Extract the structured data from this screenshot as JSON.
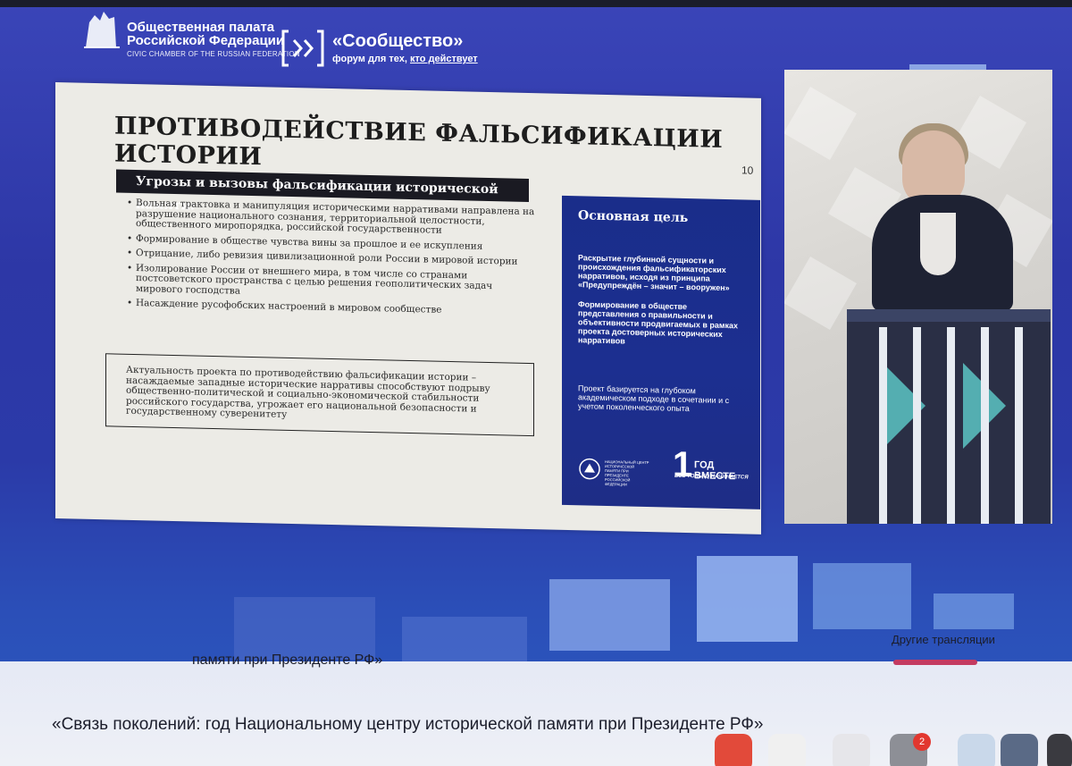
{
  "header": {
    "opp_line1": "Общественная палата",
    "opp_line2": "Российской Федерации",
    "opp_line3": "CIVIC CHAMBER OF THE RUSSIAN FEDERATION",
    "forum_title": "«Сообщество»",
    "forum_sub_prefix": "форум для тех,",
    "forum_sub_link": "кто действует"
  },
  "slide": {
    "title": "ПРОТИВОДЕЙСТВИЕ ФАЛЬСИФИКАЦИИ ИСТОРИИ",
    "page_number": "10",
    "threats_heading": "Угрозы и вызовы фальсификации исторической памяти:",
    "threats": [
      "Вольная трактовка и манипуляция историческими нарративами направлена на разрушение национального сознания, территориальной целостности, общественного миропорядка, российской государственности",
      "Формирование в обществе чувства вины за прошлое и ее искупления",
      "Отрицание, либо ревизия цивилизационной роли России в мировой истории",
      "Изолирование России от внешнего мира, в том числе со странами постсоветского пространства с целью решения геополитических задач мирового господства",
      "Насаждение русофобских настроений в мировом сообществе"
    ],
    "relevance_text": "Актуальность проекта по противодействию фальсификации истории – насаждаемые западные исторические нарративы способствуют подрыву общественно-политической и социально-экономической стабильности российского государства, угрожает его национальной безопасности и государственному суверенитету",
    "goal": {
      "title": "Основная цель",
      "p1": "Раскрытие глубинной сущности и происхождения фальсификаторских нарративов, исходя из принципа «Предупреждён – значит – вооружен»",
      "p2": "Формирование в обществе представления о правильности и объективности продвигаемых в рамках проекта достоверных исторических нарративов",
      "p3": "Проект базируется на глубоком академическом подходе в сочетании и с учетом поколенческого опыта",
      "ncip_text": "НАЦИОНАЛЬНЫЙ ЦЕНТР ИСТОРИЧЕСКОЙ ПАМЯТИ ПРИ ПРЕЗИДЕНТЕ РОССИЙСКОЙ ФЕДЕРАЦИИ",
      "god_number": "1",
      "god_title": "ГОД ВМЕСТЕ",
      "god_sub": "ВСЕ ТОЛЬКО НАЧИНАЕТСЯ"
    }
  },
  "stream": {
    "caption_overlay": "памяти при Президенте РФ»",
    "caption_main": "«Связь поколений: год Национальному центру исторической памяти при Президенте РФ»",
    "other_streams": "Другие трансляции"
  },
  "dock": {
    "badge_count": "2"
  },
  "colors": {
    "stream_bg": "#2d37a6",
    "goal_panel": "#1c2f90",
    "accent": "#c43a60"
  }
}
